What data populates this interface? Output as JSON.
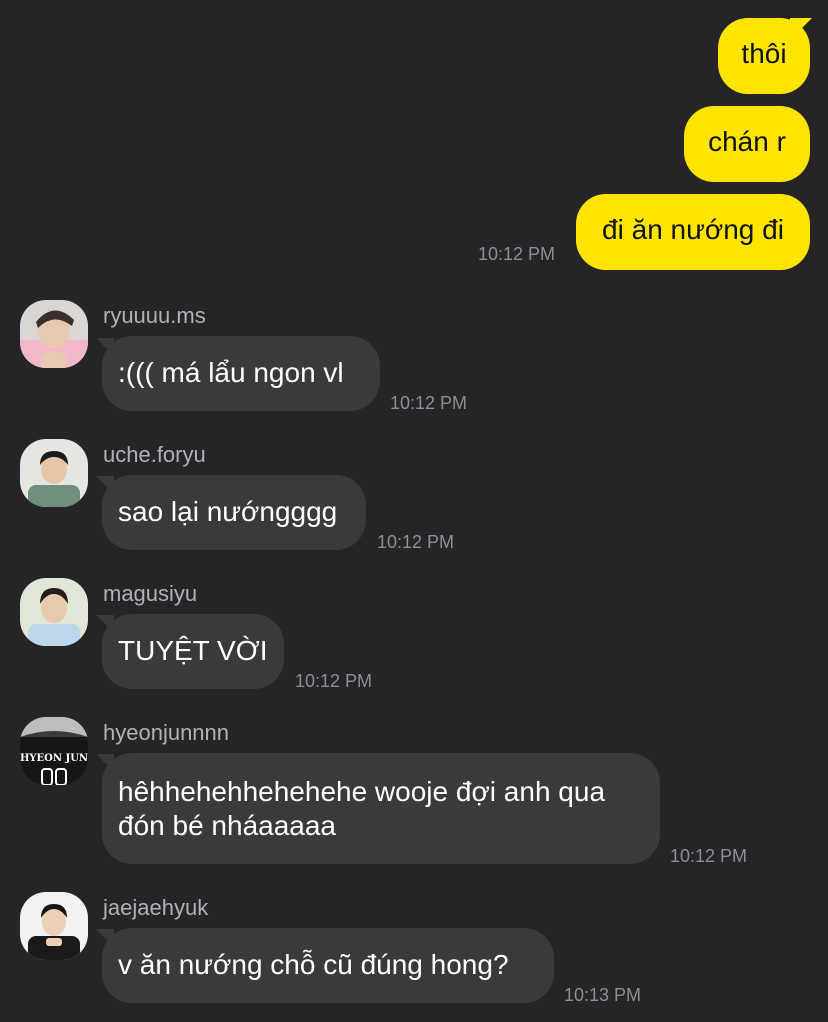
{
  "outgoing": [
    {
      "text": "thôi"
    },
    {
      "text": "chán r"
    },
    {
      "text": "đi ăn nướng đi",
      "time": "10:12 PM"
    }
  ],
  "incoming": [
    {
      "name": "ryuuuu.ms",
      "text": ":((( má lẩu ngon vl",
      "time": "10:12 PM",
      "avatar_icon": "avatar-pink-shirt"
    },
    {
      "name": "uche.foryu",
      "text": "sao lại nướngggg",
      "time": "10:12 PM",
      "avatar_icon": "avatar-green-shirt"
    },
    {
      "name": "magusiyu",
      "text": "TUYỆT VỜI",
      "time": "10:12 PM",
      "avatar_icon": "avatar-light-blue-shirt"
    },
    {
      "name": "hyeonjunnnn",
      "text": "hêhhehehhehehehe wooje đợi anh qua đón bé nháaaaaa",
      "time": "10:12 PM",
      "avatar_icon": "avatar-jersey",
      "avatar_text": "HYEON JUN"
    },
    {
      "name": "jaejaehyuk",
      "text": "v ăn nướng chỗ cũ đúng hong?",
      "time": "10:13 PM",
      "avatar_icon": "avatar-black-shirt"
    }
  ],
  "colors": {
    "background": "#252527",
    "my_bubble": "#fee500",
    "their_bubble": "#3a3a3c",
    "timestamp": "#8e8e93",
    "username": "#b2b2b6"
  }
}
